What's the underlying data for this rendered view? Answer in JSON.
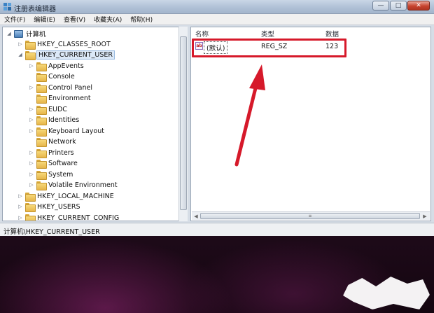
{
  "window": {
    "title": "注册表编辑器",
    "controls": {
      "minimize": "—",
      "maximize": "□",
      "close": "✕"
    }
  },
  "menu": [
    "文件(F)",
    "编辑(E)",
    "查看(V)",
    "收藏夹(A)",
    "帮助(H)"
  ],
  "tree": {
    "root": "计算机",
    "items": [
      {
        "label": "HKEY_CLASSES_ROOT",
        "expander": "▷"
      },
      {
        "label": "HKEY_CURRENT_USER",
        "expander": "◢"
      },
      {
        "label": "AppEvents",
        "expander": "▷"
      },
      {
        "label": "Console",
        "expander": ""
      },
      {
        "label": "Control Panel",
        "expander": "▷"
      },
      {
        "label": "Environment",
        "expander": ""
      },
      {
        "label": "EUDC",
        "expander": "▷"
      },
      {
        "label": "Identities",
        "expander": "▷"
      },
      {
        "label": "Keyboard Layout",
        "expander": "▷"
      },
      {
        "label": "Network",
        "expander": ""
      },
      {
        "label": "Printers",
        "expander": "▷"
      },
      {
        "label": "Software",
        "expander": "▷"
      },
      {
        "label": "System",
        "expander": "▷"
      },
      {
        "label": "Volatile Environment",
        "expander": "▷"
      },
      {
        "label": "HKEY_LOCAL_MACHINE",
        "expander": "▷"
      },
      {
        "label": "HKEY_USERS",
        "expander": "▷"
      },
      {
        "label": "HKEY_CURRENT_CONFIG",
        "expander": "▷"
      }
    ]
  },
  "list": {
    "columns": [
      "名称",
      "类型",
      "数据"
    ],
    "rows": [
      {
        "icon": "ab",
        "name": "(默认)",
        "type": "REG_SZ",
        "data": "123"
      }
    ]
  },
  "statusbar": {
    "path": "计算机\\HKEY_CURRENT_USER"
  },
  "colors": {
    "annotation": "#d6192a",
    "titlebar": "#aebfd5",
    "desktop": "#2a0f24"
  },
  "icons": {
    "app": "registry-editor-icon",
    "tree_root": "computer-icon",
    "folder": "folder-icon",
    "value": "string-value-icon"
  }
}
